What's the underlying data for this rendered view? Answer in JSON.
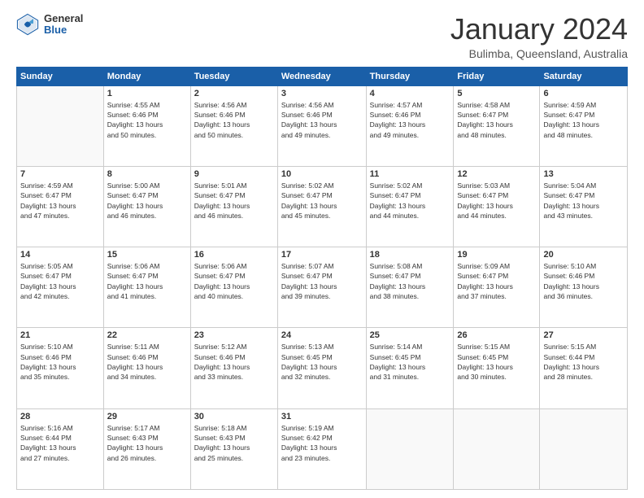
{
  "header": {
    "logo": {
      "general": "General",
      "blue": "Blue"
    },
    "title": "January 2024",
    "location": "Bulimba, Queensland, Australia"
  },
  "days_of_week": [
    "Sunday",
    "Monday",
    "Tuesday",
    "Wednesday",
    "Thursday",
    "Friday",
    "Saturday"
  ],
  "weeks": [
    [
      {
        "day": "",
        "info": ""
      },
      {
        "day": "1",
        "info": "Sunrise: 4:55 AM\nSunset: 6:46 PM\nDaylight: 13 hours\nand 50 minutes."
      },
      {
        "day": "2",
        "info": "Sunrise: 4:56 AM\nSunset: 6:46 PM\nDaylight: 13 hours\nand 50 minutes."
      },
      {
        "day": "3",
        "info": "Sunrise: 4:56 AM\nSunset: 6:46 PM\nDaylight: 13 hours\nand 49 minutes."
      },
      {
        "day": "4",
        "info": "Sunrise: 4:57 AM\nSunset: 6:46 PM\nDaylight: 13 hours\nand 49 minutes."
      },
      {
        "day": "5",
        "info": "Sunrise: 4:58 AM\nSunset: 6:47 PM\nDaylight: 13 hours\nand 48 minutes."
      },
      {
        "day": "6",
        "info": "Sunrise: 4:59 AM\nSunset: 6:47 PM\nDaylight: 13 hours\nand 48 minutes."
      }
    ],
    [
      {
        "day": "7",
        "info": "Sunrise: 4:59 AM\nSunset: 6:47 PM\nDaylight: 13 hours\nand 47 minutes."
      },
      {
        "day": "8",
        "info": "Sunrise: 5:00 AM\nSunset: 6:47 PM\nDaylight: 13 hours\nand 46 minutes."
      },
      {
        "day": "9",
        "info": "Sunrise: 5:01 AM\nSunset: 6:47 PM\nDaylight: 13 hours\nand 46 minutes."
      },
      {
        "day": "10",
        "info": "Sunrise: 5:02 AM\nSunset: 6:47 PM\nDaylight: 13 hours\nand 45 minutes."
      },
      {
        "day": "11",
        "info": "Sunrise: 5:02 AM\nSunset: 6:47 PM\nDaylight: 13 hours\nand 44 minutes."
      },
      {
        "day": "12",
        "info": "Sunrise: 5:03 AM\nSunset: 6:47 PM\nDaylight: 13 hours\nand 44 minutes."
      },
      {
        "day": "13",
        "info": "Sunrise: 5:04 AM\nSunset: 6:47 PM\nDaylight: 13 hours\nand 43 minutes."
      }
    ],
    [
      {
        "day": "14",
        "info": "Sunrise: 5:05 AM\nSunset: 6:47 PM\nDaylight: 13 hours\nand 42 minutes."
      },
      {
        "day": "15",
        "info": "Sunrise: 5:06 AM\nSunset: 6:47 PM\nDaylight: 13 hours\nand 41 minutes."
      },
      {
        "day": "16",
        "info": "Sunrise: 5:06 AM\nSunset: 6:47 PM\nDaylight: 13 hours\nand 40 minutes."
      },
      {
        "day": "17",
        "info": "Sunrise: 5:07 AM\nSunset: 6:47 PM\nDaylight: 13 hours\nand 39 minutes."
      },
      {
        "day": "18",
        "info": "Sunrise: 5:08 AM\nSunset: 6:47 PM\nDaylight: 13 hours\nand 38 minutes."
      },
      {
        "day": "19",
        "info": "Sunrise: 5:09 AM\nSunset: 6:47 PM\nDaylight: 13 hours\nand 37 minutes."
      },
      {
        "day": "20",
        "info": "Sunrise: 5:10 AM\nSunset: 6:46 PM\nDaylight: 13 hours\nand 36 minutes."
      }
    ],
    [
      {
        "day": "21",
        "info": "Sunrise: 5:10 AM\nSunset: 6:46 PM\nDaylight: 13 hours\nand 35 minutes."
      },
      {
        "day": "22",
        "info": "Sunrise: 5:11 AM\nSunset: 6:46 PM\nDaylight: 13 hours\nand 34 minutes."
      },
      {
        "day": "23",
        "info": "Sunrise: 5:12 AM\nSunset: 6:46 PM\nDaylight: 13 hours\nand 33 minutes."
      },
      {
        "day": "24",
        "info": "Sunrise: 5:13 AM\nSunset: 6:45 PM\nDaylight: 13 hours\nand 32 minutes."
      },
      {
        "day": "25",
        "info": "Sunrise: 5:14 AM\nSunset: 6:45 PM\nDaylight: 13 hours\nand 31 minutes."
      },
      {
        "day": "26",
        "info": "Sunrise: 5:15 AM\nSunset: 6:45 PM\nDaylight: 13 hours\nand 30 minutes."
      },
      {
        "day": "27",
        "info": "Sunrise: 5:15 AM\nSunset: 6:44 PM\nDaylight: 13 hours\nand 28 minutes."
      }
    ],
    [
      {
        "day": "28",
        "info": "Sunrise: 5:16 AM\nSunset: 6:44 PM\nDaylight: 13 hours\nand 27 minutes."
      },
      {
        "day": "29",
        "info": "Sunrise: 5:17 AM\nSunset: 6:43 PM\nDaylight: 13 hours\nand 26 minutes."
      },
      {
        "day": "30",
        "info": "Sunrise: 5:18 AM\nSunset: 6:43 PM\nDaylight: 13 hours\nand 25 minutes."
      },
      {
        "day": "31",
        "info": "Sunrise: 5:19 AM\nSunset: 6:42 PM\nDaylight: 13 hours\nand 23 minutes."
      },
      {
        "day": "",
        "info": ""
      },
      {
        "day": "",
        "info": ""
      },
      {
        "day": "",
        "info": ""
      }
    ]
  ]
}
